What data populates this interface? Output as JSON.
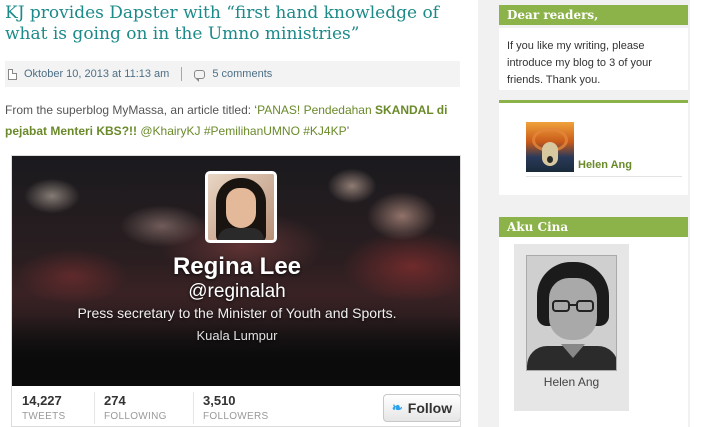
{
  "post": {
    "title": "KJ provides Dapster with “first hand knowledge of what is going on in the Umno ministries”",
    "date": "Oktober 10, 2013 at 11:13 am",
    "comments": "5 comments",
    "intro_prefix": "From the superblog MyMassa, an article titled: ‘",
    "intro_link_a": "PANAS! Pendedahan ",
    "intro_link_bold": "SKANDAL di pejabat Menteri KBS?!!",
    "intro_link_b": " @KhairyKJ #PemilihanUMNO #KJ4KP",
    "intro_suffix": "’"
  },
  "twitter_card": {
    "name": "Regina Lee",
    "handle": "@reginalah",
    "bio": "Press secretary to the Minister of Youth and Sports.",
    "location": "Kuala Lumpur",
    "stats": [
      {
        "value": "14,227",
        "label": "TWEETS"
      },
      {
        "value": "274",
        "label": "FOLLOWING"
      },
      {
        "value": "3,510",
        "label": "FOLLOWERS"
      }
    ],
    "follow_label": "Follow",
    "bird_icon": "❧"
  },
  "sidebar": {
    "dear_readers": {
      "title": "Dear readers,",
      "text": "If you like my writing, please introduce my blog to 3 of your friends. Thank you."
    },
    "author": {
      "name": "Helen Ang"
    },
    "aku_cina": {
      "title": "Aku Cina",
      "caption": "Helen Ang"
    }
  },
  "colors": {
    "title_teal": "#1d8a8a",
    "widget_green": "#8cb24a",
    "link_green": "#6a8a2a",
    "twitter_blue": "#2aa3ef"
  }
}
